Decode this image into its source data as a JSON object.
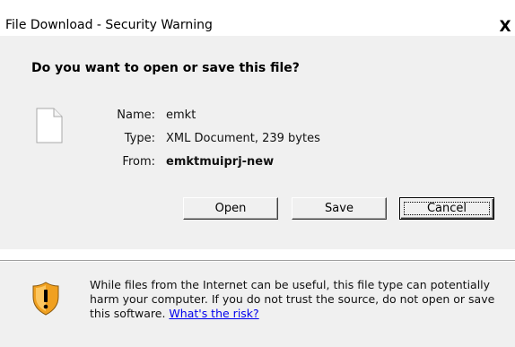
{
  "window": {
    "title": "File Download - Security Warning",
    "close_label": "X"
  },
  "dialog": {
    "question": "Do you want to open or save this file?",
    "file": {
      "icon": "generic-file-icon",
      "name_label": "Name:",
      "name_value": "emkt",
      "type_label": "Type:",
      "type_value": "XML Document, 239 bytes",
      "from_label": "From:",
      "from_value": "emktmuiprj-new"
    },
    "buttons": {
      "open": "Open",
      "save": "Save",
      "cancel": "Cancel"
    }
  },
  "warning": {
    "icon": "security-shield-icon",
    "text": "While files from the Internet can be useful, this file type can potentially harm your computer. If you do not trust the source, do not open or save this software.",
    "link": "What's the risk?"
  },
  "colors": {
    "panel": "#f0f0f0",
    "link": "#0000ee",
    "shield_orange": "#f0a020"
  }
}
